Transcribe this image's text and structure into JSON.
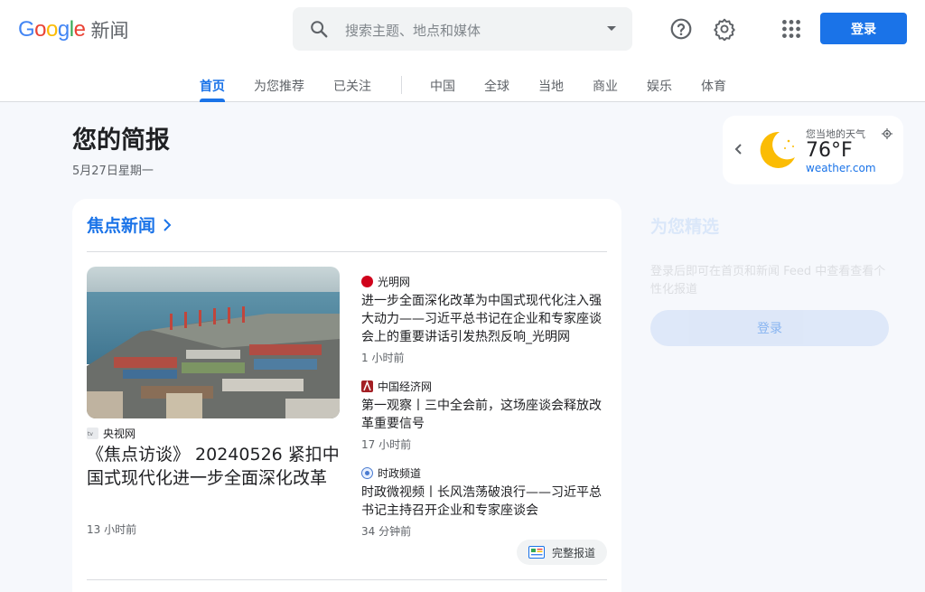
{
  "header": {
    "logo_google": "Google",
    "logo_news": "新闻",
    "search_placeholder": "搜索主题、地点和媒体",
    "signin_label": "登录",
    "icons": [
      "help-icon",
      "settings-icon",
      "apps-icon"
    ]
  },
  "tabs": [
    {
      "label": "首页",
      "active": true
    },
    {
      "label": "为您推荐"
    },
    {
      "label": "已关注"
    },
    {
      "label": "中国"
    },
    {
      "label": "全球"
    },
    {
      "label": "当地"
    },
    {
      "label": "商业"
    },
    {
      "label": "娱乐"
    },
    {
      "label": "体育"
    }
  ],
  "briefing": {
    "title": "您的简报",
    "date": "5月27日星期一"
  },
  "weather": {
    "label": "您当地的天气",
    "temp": "76°F",
    "source": "weather.com"
  },
  "focus": {
    "heading": "焦点新闻",
    "hero": {
      "source": "央视网",
      "title": "《焦点访谈》 20240526 紧扣中国式现代化进一步全面深化改革",
      "time": "13 小时前"
    },
    "stories": [
      {
        "source": "光明网",
        "title": "进一步全面深化改革为中国式现代化注入强大动力——习近平总书记在企业和专家座谈会上的重要讲话引发热烈反响_光明网",
        "time": "1 小时前"
      },
      {
        "source": "中国经济网",
        "title": "第一观察丨三中全会前，这场座谈会释放改革重要信号",
        "time": "17 小时前"
      },
      {
        "source": "时政频道",
        "title": "时政微视频丨长风浩荡破浪行——习近平总书记主持召开企业和专家座谈会",
        "time": "34 分钟前"
      }
    ],
    "full_coverage_label": "完整报道"
  },
  "recommend": {
    "title": "为您精选",
    "text": "登录后即可在首页和新闻 Feed 中查看查看个性化报道",
    "button": "登录"
  },
  "colors": {
    "accent": "#1a73e8",
    "background": "#f6f8fc"
  }
}
